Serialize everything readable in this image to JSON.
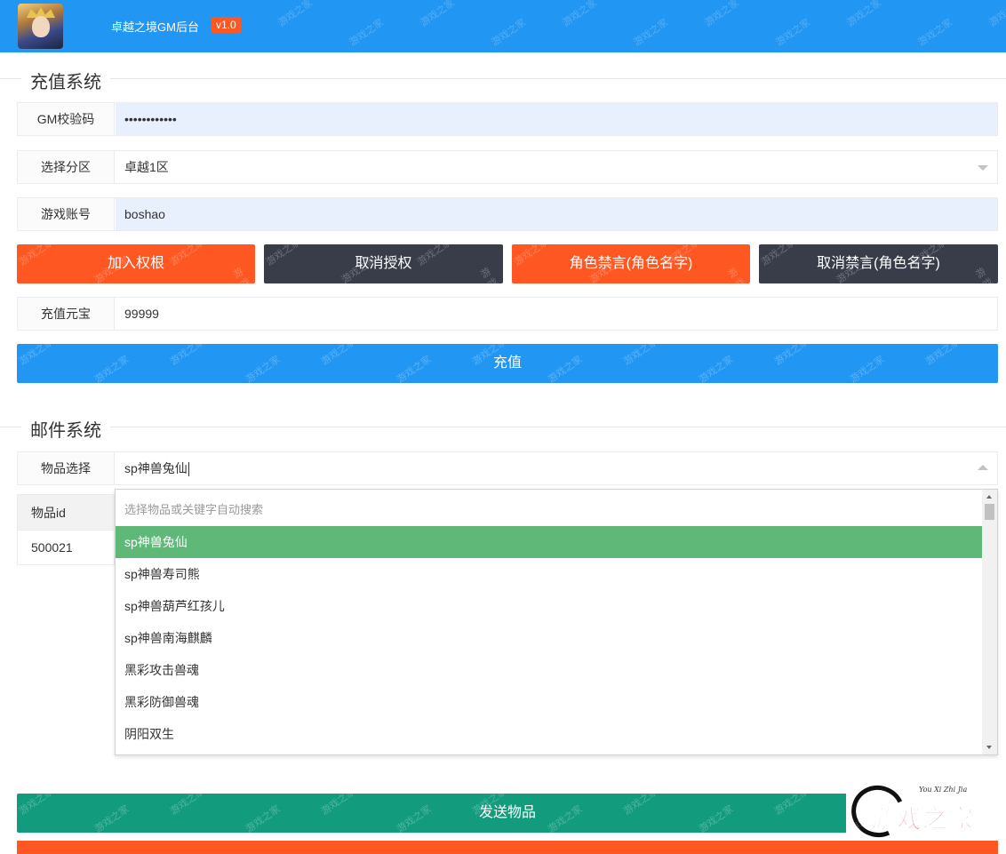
{
  "header": {
    "app_title": "卓越之境GM后台",
    "version": "v1.0",
    "avatar_icon": "game-character-avatar"
  },
  "watermark_text": "游戏之家",
  "recharge_section": {
    "title": "充值系统",
    "gm_code": {
      "label": "GM校验码",
      "value": "••••••••••••"
    },
    "server": {
      "label": "选择分区",
      "value": "卓越1区"
    },
    "account": {
      "label": "游戏账号",
      "value": "boshao"
    },
    "buttons": {
      "add_permission": "加入权根",
      "cancel_auth": "取消授权",
      "mute_role": "角色禁言(角色名字)",
      "unmute_role": "取消禁言(角色名字)"
    },
    "amount": {
      "label": "充值元宝",
      "value": "99999"
    },
    "recharge_button": "充值"
  },
  "mail_section": {
    "title": "邮件系统",
    "item_select": {
      "label": "物品选择",
      "value": "sp神兽兔仙"
    },
    "item_table": {
      "header": "物品id",
      "value": "500021"
    },
    "dropdown": {
      "placeholder": "选择物品或关键字自动搜索",
      "options": [
        "sp神兽兔仙",
        "sp神兽寿司熊",
        "sp神兽葫芦红孩儿",
        "sp神兽南海麒麟",
        "黑彩攻击兽魂",
        "黑彩防御兽魂",
        "阴阳双生"
      ],
      "selected_index": 0
    },
    "send_button": "发送物品"
  },
  "site_logo": {
    "small_text": "You Xi Zhi Jia",
    "big_text": "游戏之家"
  },
  "colors": {
    "header_blue": "#2196f3",
    "orange": "#ff5722",
    "dark": "#393d49",
    "teal": "#139b7d",
    "selected_green": "#5fb878",
    "input_fill": "#e8f0fe"
  }
}
